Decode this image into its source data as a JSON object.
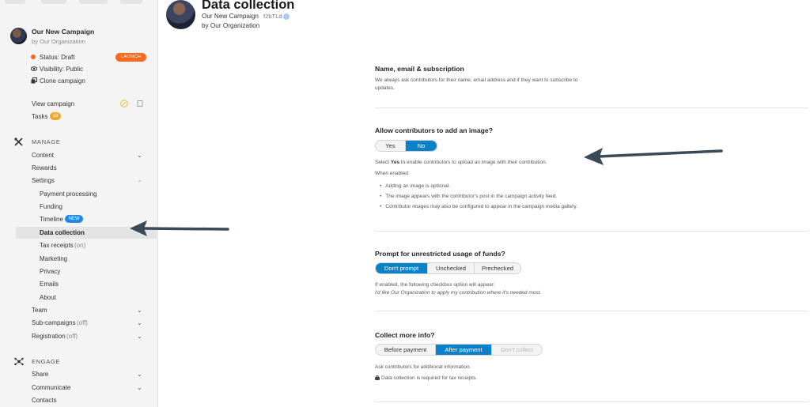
{
  "sidebar": {
    "campaign": {
      "title": "Our New Campaign",
      "org": "by Our Organization"
    },
    "status": "Status: Draft",
    "launch": "LAUNCH",
    "visibility": "Visibility: Public",
    "clone": "Clone campaign",
    "view_campaign": "View campaign",
    "tasks": "Tasks",
    "tasks_count": "18",
    "manage": "MANAGE",
    "content": "Content",
    "rewards": "Rewards",
    "settings": "Settings",
    "sub": {
      "payment": "Payment processing",
      "funding": "Funding",
      "timeline": "Timeline",
      "new_badge": "NEW",
      "data_collection": "Data collection",
      "tax_receipts": "Tax receipts",
      "tax_receipts_state": "(on)",
      "marketing": "Marketing",
      "privacy": "Privacy",
      "emails": "Emails",
      "about": "About"
    },
    "team": "Team",
    "sub_campaigns": "Sub-campaigns",
    "sub_campaigns_state": "(off)",
    "registration": "Registration",
    "registration_state": "(off)",
    "engage": "ENGAGE",
    "share": "Share",
    "communicate": "Communicate",
    "contacts": "Contacts"
  },
  "header": {
    "title": "Data collection",
    "campaign": "Our New Campaign",
    "code": "f2bTLd",
    "org": "by Our Organization"
  },
  "sections": {
    "name_email": {
      "title": "Name, email & subscription",
      "desc1": "We always ask contributors for their name, email address and if they want to subscribe to",
      "desc2": "updates."
    },
    "image": {
      "title": "Allow contributors to add an image?",
      "options": [
        "Yes",
        "No"
      ],
      "selected": "No",
      "select_pre": "Select ",
      "select_yes": "Yes",
      "select_post": " to enable contributors to upload an image with their contribution.",
      "when": "When enabled:",
      "bullets": [
        "Adding an image is optional.",
        "The image appears with the contributor's post in the campaign activity feed.",
        "Contributor images may also be configured to appear in the campaign media gallery."
      ]
    },
    "funds": {
      "title": "Prompt for unrestricted usage of funds?",
      "options": [
        "Don't prompt",
        "Unchecked",
        "Prechecked"
      ],
      "selected": "Don't prompt",
      "desc1": "If enabled, the following checkbox option will appear:",
      "desc2": "I'd like Our Organization to apply my contribution where it's needed most."
    },
    "more_info": {
      "title": "Collect more info?",
      "options": [
        "Before payment",
        "After payment",
        "Don't collect"
      ],
      "selected": "After payment",
      "disabled": "Don't collect",
      "desc": "Ask contributors for additional information.",
      "note": "Data collection is required for tax receipts."
    }
  },
  "colors": {
    "accent": "#0a82c9",
    "launch": "#f26b21",
    "tasks_badge": "#f5a623",
    "new_badge": "#1e88e5",
    "annotation_arrow": "#3b4a57"
  }
}
